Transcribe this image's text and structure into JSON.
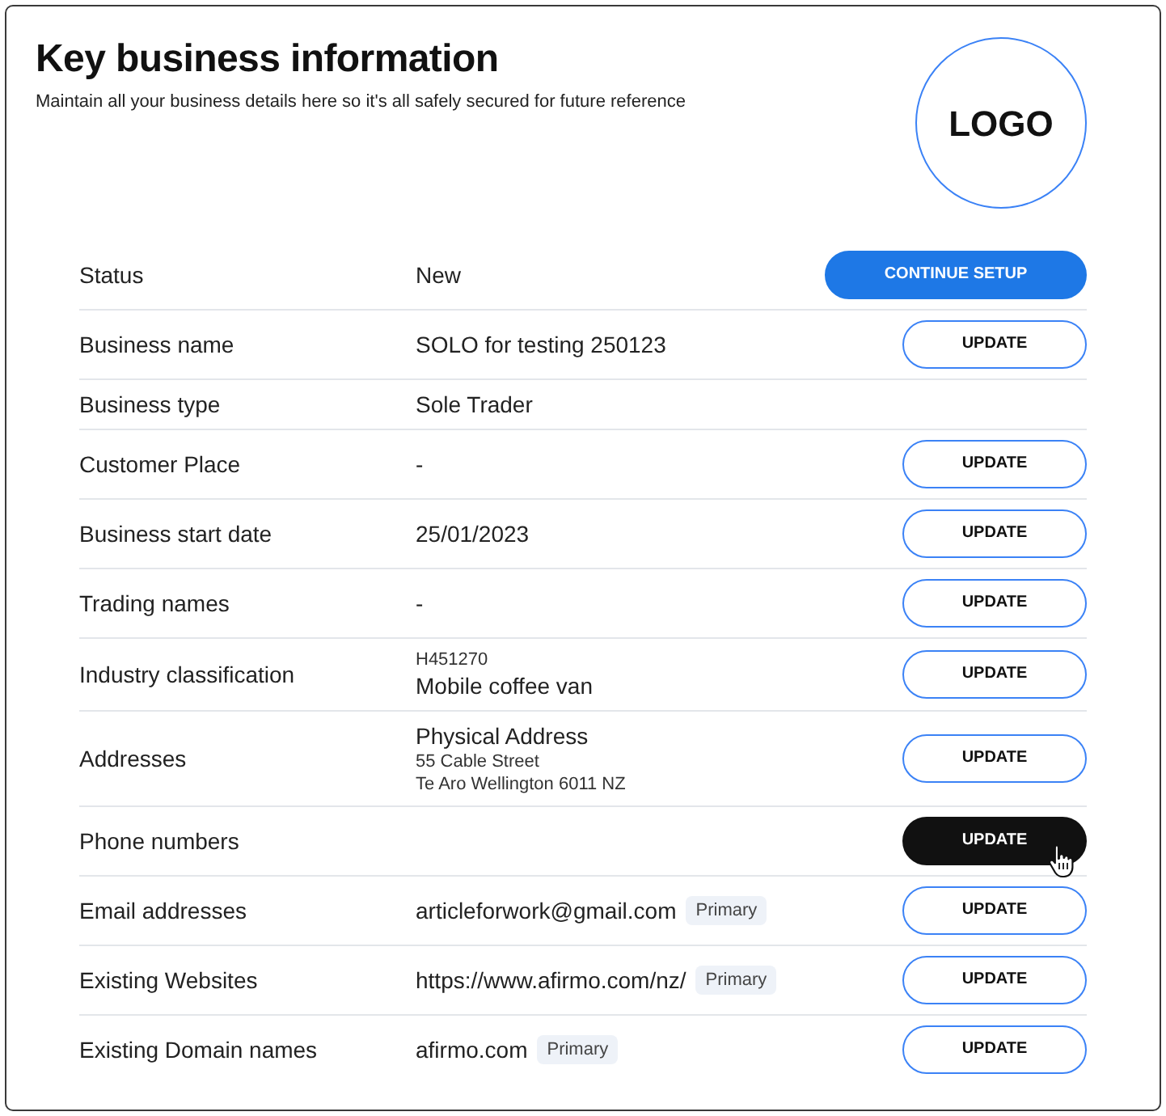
{
  "header": {
    "title": "Key business information",
    "subtitle": "Maintain all your business details here so it's all safely secured for future reference",
    "logo": "LOGO"
  },
  "rows": [
    {
      "label": "Status",
      "kind": "text",
      "value": "New",
      "button": {
        "label": "CONTINUE SETUP",
        "kind": "primary",
        "hovered": false
      }
    },
    {
      "label": "Business name",
      "kind": "text",
      "value": "SOLO for testing 250123",
      "button": {
        "label": "UPDATE",
        "kind": "outline",
        "hovered": false
      }
    },
    {
      "label": "Business type",
      "kind": "text",
      "value": "Sole Trader"
    },
    {
      "label": "Customer Place",
      "kind": "text",
      "value": "-",
      "button": {
        "label": "UPDATE",
        "kind": "outline",
        "hovered": false
      }
    },
    {
      "label": "Business start date",
      "kind": "text",
      "value": "25/01/2023",
      "button": {
        "label": "UPDATE",
        "kind": "outline",
        "hovered": false
      }
    },
    {
      "label": "Trading names",
      "kind": "text",
      "value": "-",
      "button": {
        "label": "UPDATE",
        "kind": "outline",
        "hovered": false
      }
    },
    {
      "label": "Industry classification",
      "kind": "classified",
      "code": "H451270",
      "value": "Mobile coffee van",
      "button": {
        "label": "UPDATE",
        "kind": "outline",
        "hovered": false
      }
    },
    {
      "label": "Addresses",
      "kind": "address",
      "value": "Physical Address",
      "lines": [
        "55 Cable Street",
        "Te Aro Wellington 6011 NZ"
      ],
      "button": {
        "label": "UPDATE",
        "kind": "outline",
        "hovered": false
      }
    },
    {
      "label": "Phone numbers",
      "kind": "blank",
      "button": {
        "label": "UPDATE",
        "kind": "outline",
        "hovered": true
      }
    },
    {
      "label": "Email addresses",
      "kind": "text",
      "value": "articleforwork@gmail.com",
      "badge": "Primary",
      "button": {
        "label": "UPDATE",
        "kind": "outline",
        "hovered": false
      }
    },
    {
      "label": "Existing Websites",
      "kind": "text",
      "value": "https://www.afirmo.com/nz/",
      "badge": "Primary",
      "button": {
        "label": "UPDATE",
        "kind": "outline",
        "hovered": false
      }
    },
    {
      "label": "Existing Domain names",
      "kind": "text",
      "value": "afirmo.com",
      "badge": "Primary",
      "button": {
        "label": "UPDATE",
        "kind": "outline",
        "hovered": false
      }
    }
  ]
}
